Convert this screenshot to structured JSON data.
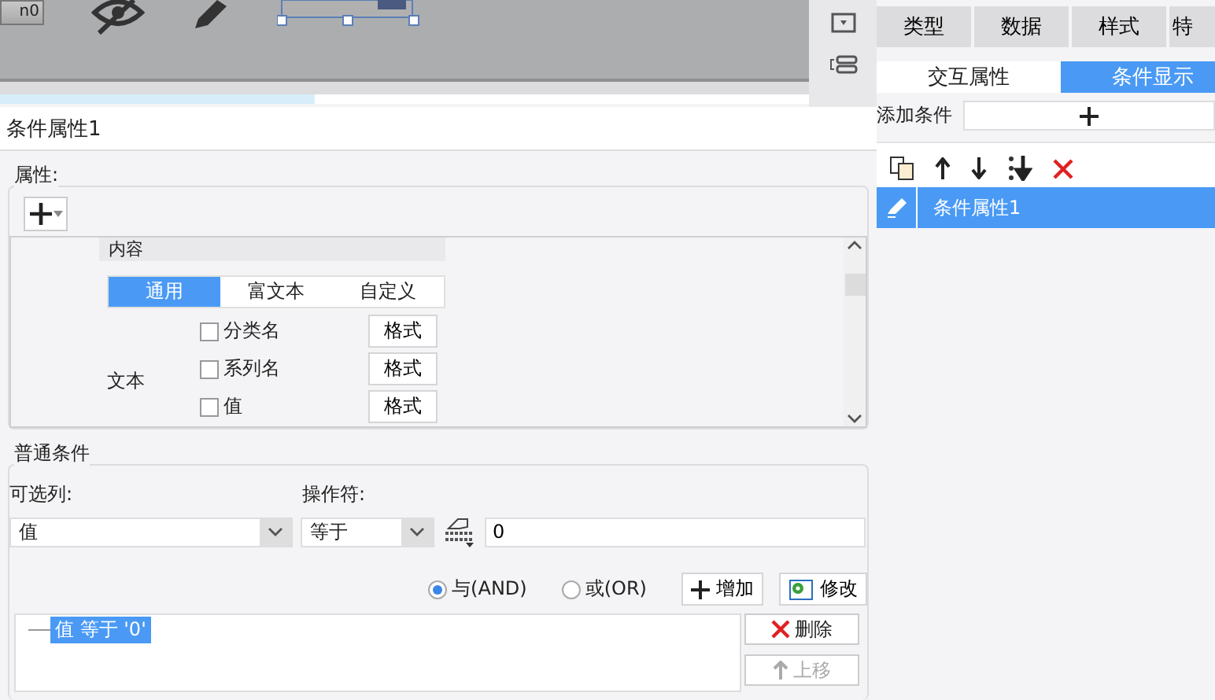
{
  "canvas": {
    "button_label": "n0"
  },
  "dialog": {
    "title": "条件属性1",
    "properties": {
      "legend": "属性:",
      "dropdown": "内容",
      "tabs": [
        {
          "label": "通用",
          "selected": true
        },
        {
          "label": "富文本",
          "selected": false
        },
        {
          "label": "自定义",
          "selected": false
        }
      ],
      "group_label": "文本",
      "rows": [
        {
          "label": "分类名",
          "checked": false,
          "button": "格式"
        },
        {
          "label": "系列名",
          "checked": false,
          "button": "格式"
        },
        {
          "label": "值",
          "checked": false,
          "button": "格式"
        }
      ]
    },
    "condition": {
      "legend": "普通条件",
      "column_label": "可选列:",
      "column_value": "值",
      "operator_label": "操作符:",
      "operator_value": "等于",
      "value": "0",
      "logic": [
        {
          "label": "与(AND)",
          "selected": true
        },
        {
          "label": "或(OR)",
          "selected": false
        }
      ],
      "add_button": "增加",
      "edit_button": "修改",
      "items": [
        {
          "text": "值 等于 '0'",
          "selected": true
        }
      ],
      "side_buttons": [
        {
          "label": "删除",
          "kind": "delete",
          "disabled": false
        },
        {
          "label": "上移",
          "kind": "up",
          "disabled": true
        }
      ]
    }
  },
  "panel": {
    "tabs": [
      {
        "label": "类型",
        "selected": false
      },
      {
        "label": "数据",
        "selected": false
      },
      {
        "label": "样式",
        "selected": false
      },
      {
        "label": "特",
        "selected": false
      }
    ],
    "subtabs": [
      {
        "label": "交互属性",
        "selected": false
      },
      {
        "label": "条件显示",
        "selected": true
      }
    ],
    "add_label": "添加条件",
    "list": [
      {
        "label": "条件属性1",
        "selected": true
      }
    ]
  }
}
